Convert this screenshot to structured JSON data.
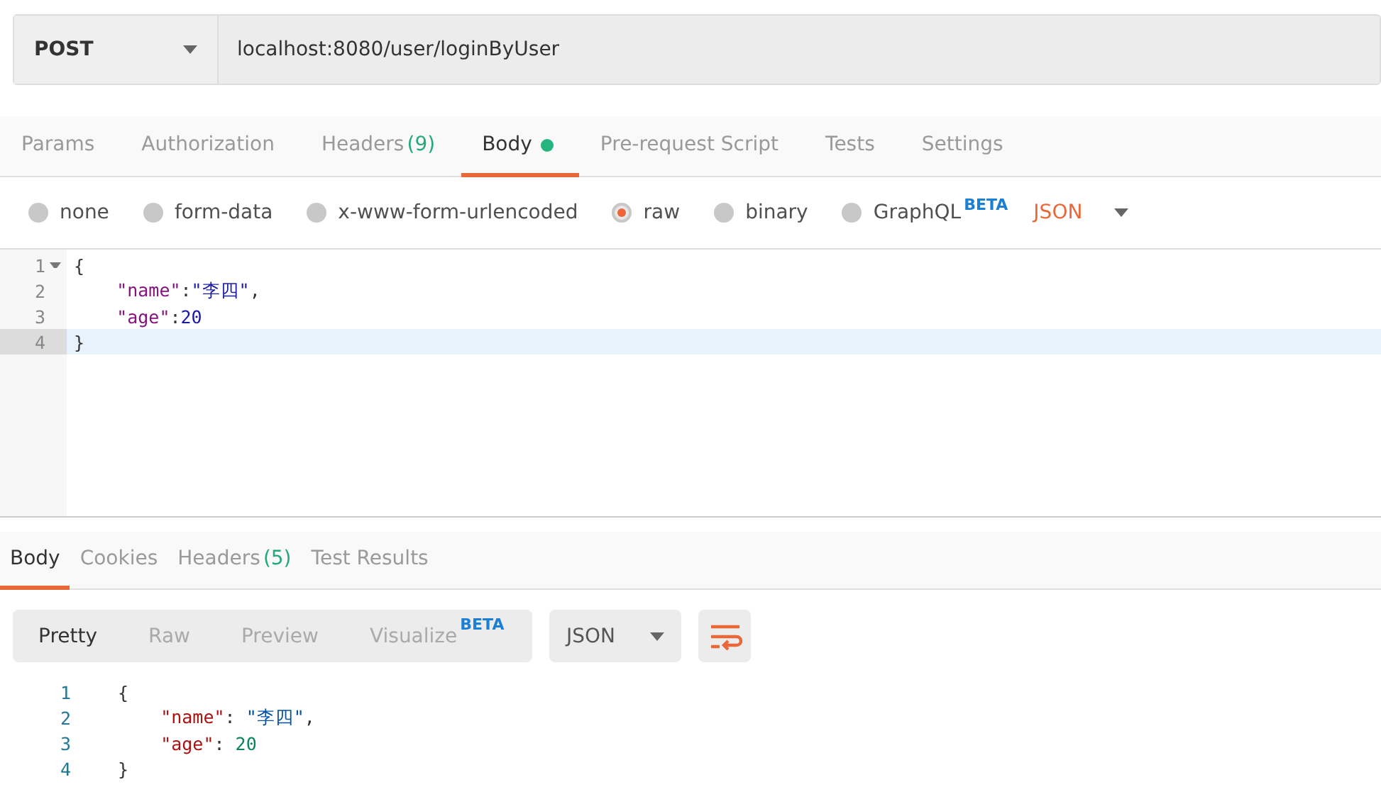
{
  "request": {
    "method": "POST",
    "url": "localhost:8080/user/loginByUser"
  },
  "request_tabs": [
    {
      "label": "Params",
      "selected": false
    },
    {
      "label": "Authorization",
      "selected": false
    },
    {
      "label": "Headers",
      "count": "(9)",
      "selected": false
    },
    {
      "label": "Body",
      "dot": true,
      "selected": true
    },
    {
      "label": "Pre-request Script",
      "selected": false
    },
    {
      "label": "Tests",
      "selected": false
    },
    {
      "label": "Settings",
      "selected": false
    }
  ],
  "body_types": [
    {
      "label": "none",
      "selected": false
    },
    {
      "label": "form-data",
      "selected": false
    },
    {
      "label": "x-www-form-urlencoded",
      "selected": false
    },
    {
      "label": "raw",
      "selected": true
    },
    {
      "label": "binary",
      "selected": false
    },
    {
      "label": "GraphQL",
      "badge": "BETA",
      "selected": false
    }
  ],
  "raw_format": "JSON",
  "request_editor": [
    {
      "number": "1",
      "foldable": true,
      "active": false,
      "tokens": [
        {
          "kind": "punct",
          "text": "{"
        }
      ]
    },
    {
      "number": "2",
      "foldable": false,
      "active": false,
      "indented": true,
      "tokens": [
        {
          "kind": "key",
          "text": "\"name\""
        },
        {
          "kind": "punct",
          "text": ":"
        },
        {
          "kind": "str",
          "text": "\"李四\""
        },
        {
          "kind": "punct",
          "text": ","
        }
      ]
    },
    {
      "number": "3",
      "foldable": false,
      "active": false,
      "indented": true,
      "tokens": [
        {
          "kind": "key",
          "text": "\"age\""
        },
        {
          "kind": "punct",
          "text": ":"
        },
        {
          "kind": "num",
          "text": "20"
        }
      ]
    },
    {
      "number": "4",
      "foldable": false,
      "active": true,
      "tokens": [
        {
          "kind": "punct",
          "text": "}"
        }
      ]
    }
  ],
  "response_tabs": [
    {
      "label": "Body",
      "selected": true
    },
    {
      "label": "Cookies",
      "selected": false
    },
    {
      "label": "Headers",
      "count": "(5)",
      "selected": false
    },
    {
      "label": "Test Results",
      "selected": false
    }
  ],
  "view_modes": [
    {
      "label": "Pretty",
      "selected": true
    },
    {
      "label": "Raw",
      "selected": false
    },
    {
      "label": "Preview",
      "selected": false
    },
    {
      "label": "Visualize",
      "badge": "BETA",
      "selected": false
    }
  ],
  "response_format": "JSON",
  "response_body": [
    {
      "number": "1",
      "tokens": [
        {
          "kind": "punct",
          "text": "{"
        }
      ]
    },
    {
      "number": "2",
      "indented": true,
      "tokens": [
        {
          "kind": "rkey",
          "text": "\"name\""
        },
        {
          "kind": "punct",
          "text": ": "
        },
        {
          "kind": "rstr",
          "text": "\"李四\""
        },
        {
          "kind": "punct",
          "text": ","
        }
      ]
    },
    {
      "number": "3",
      "indented": true,
      "tokens": [
        {
          "kind": "rkey",
          "text": "\"age\""
        },
        {
          "kind": "punct",
          "text": ": "
        },
        {
          "kind": "rnum",
          "text": "20"
        }
      ]
    },
    {
      "number": "4",
      "tokens": [
        {
          "kind": "punct",
          "text": "}"
        }
      ]
    }
  ]
}
